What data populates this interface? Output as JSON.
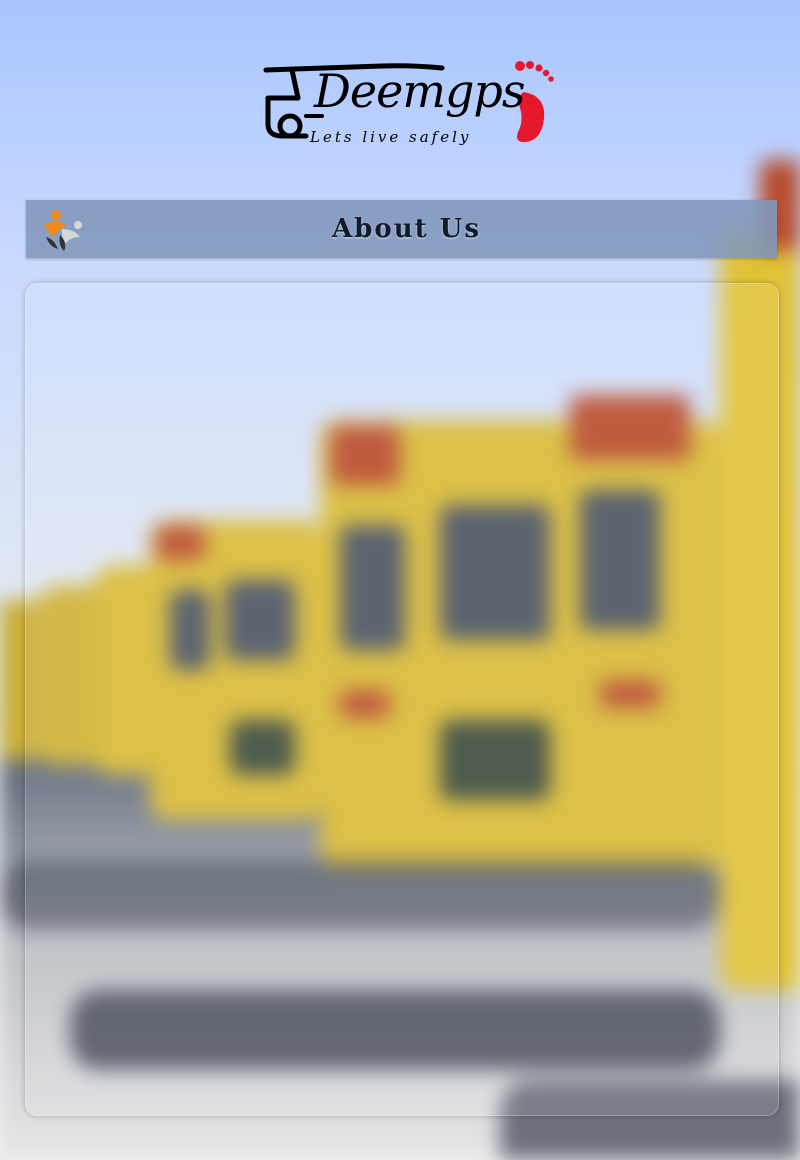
{
  "header": {
    "brand_name": "Deemgps",
    "tagline": "Lets live safely"
  },
  "title_bar": {
    "title": "About Us",
    "icon": "people-logo-icon"
  },
  "background": {
    "description_icon": "school-bus-background",
    "sky_color": "#a9c6ff",
    "bus_color": "#d8b934"
  },
  "content_panel": {
    "text": ""
  }
}
